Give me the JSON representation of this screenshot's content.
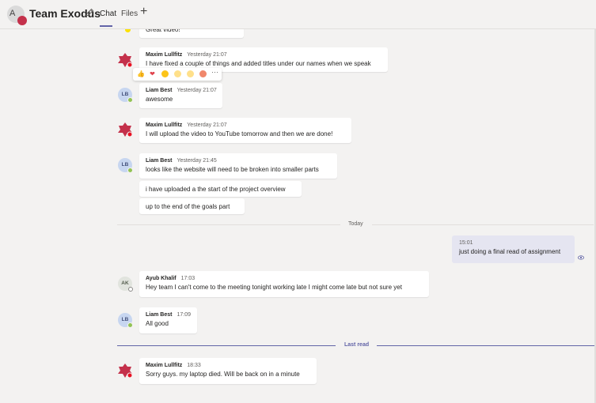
{
  "header": {
    "avatar_letter": "A",
    "team_name": "Team Exodus",
    "tabs": [
      {
        "label": "Chat"
      },
      {
        "label": "Files"
      }
    ],
    "add_tab": "+"
  },
  "messages": [
    {
      "text": "Great video!"
    },
    {
      "author": "Maxim Lullfitz",
      "time": "Yesterday 21:07",
      "text": "I have fixed a couple of things and added titles under our names when we speak"
    },
    {
      "author": "Liam Best",
      "initials": "LB",
      "time": "Yesterday 21:07",
      "text": "awesome"
    },
    {
      "author": "Maxim Lullfitz",
      "time": "Yesterday 21:07",
      "text": "I will upload the video to YouTube tomorrow and then we are done!"
    },
    {
      "author": "Liam Best",
      "initials": "LB",
      "time": "Yesterday 21:45",
      "text": "looks like the website will need to be broken into smaller parts",
      "followups": [
        "i have uploaded a the start of the project overview",
        "up to the end of the goals part"
      ]
    },
    {
      "divider": "Today"
    },
    {
      "mine": true,
      "time": "15:01",
      "text": "just doing a final read of assignment"
    },
    {
      "author": "Ayub Khalif",
      "initials": "AK",
      "time": "17:03",
      "text": "Hey team I can't come to the meeting tonight working late I might come late but not sure yet"
    },
    {
      "author": "Liam Best",
      "initials": "LB",
      "time": "17:09",
      "text": "All good"
    },
    {
      "divider": "Last read"
    },
    {
      "author": "Maxim Lullfitz",
      "time": "18:33",
      "text": "Sorry guys. my laptop died. Will be back on in a minute"
    }
  ],
  "reactions": [
    "like",
    "heart",
    "laugh",
    "surprised",
    "sad",
    "angry",
    "more"
  ],
  "colors": {
    "accent": "#6264a7",
    "online": "#92c353",
    "maxim_red": "#c4314b",
    "my_bubble": "#e5e5f1"
  }
}
